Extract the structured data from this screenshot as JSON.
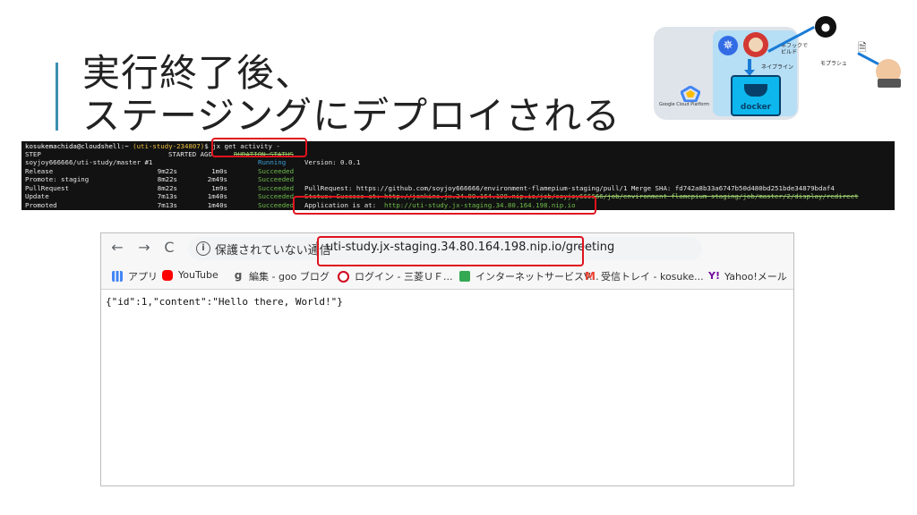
{
  "slide": {
    "title_line1": "実行終了後、",
    "title_line2": "ステージングにデプロイされる"
  },
  "diagram": {
    "gcp_label": "Google Cloud Platform",
    "docker_label": "docker",
    "label_build": "ビルド",
    "label_build_top": "ネフックで",
    "label_pipeline": "ネイプライン",
    "label_dev": "モプラシュ"
  },
  "terminal": {
    "prompt_user": "kosukemachida@cloudshell:~",
    "prompt_project": "(uti-study-234807)",
    "prompt_cmd": "$ jx get activity -",
    "header_step": "STEP",
    "header_started": "STARTED AGO",
    "header_duration_status": "DURATION STATUS",
    "rows": [
      {
        "step": "soyjoy666666/uti-study/master #1",
        "ago": "",
        "dur": "",
        "status": "Running",
        "detail": "Version: 0.0.1"
      },
      {
        "step": "  Release",
        "ago": "9m22s",
        "dur": "1m0s",
        "status": "Succeeded",
        "detail": ""
      },
      {
        "step": "  Promote: staging",
        "ago": "8m22s",
        "dur": "2m49s",
        "status": "Succeeded",
        "detail": ""
      },
      {
        "step": "    PullRequest",
        "ago": "8m22s",
        "dur": "1m9s",
        "status": "Succeeded",
        "detail": "PullRequest: https://github.com/soyjoy666666/environment-flamepium-staging/pull/1 Merge SHA: fd742a8b33a6747b50d480bd251bde34879bdaf4"
      },
      {
        "step": "    Update",
        "ago": "7m13s",
        "dur": "1m40s",
        "status": "Succeeded",
        "detail": "Status: Success at: http://jenkins.jx.34.80.164.198.nip.io/job/soyjoy666666/job/environment-flamepium-staging/job/master/2/display/redirect"
      },
      {
        "step": "    Promoted",
        "ago": "7m13s",
        "dur": "1m40s",
        "status": "Succeeded",
        "detail": "Application is at: ",
        "link": "http://uti-study.jx-staging.34.80.164.198.nip.io"
      }
    ]
  },
  "browser": {
    "back_icon": "←",
    "forward_icon": "→",
    "reload_icon": "C",
    "home_icon": "⌂",
    "info_icon": "i",
    "not_secure": "保護されていない通信",
    "url": "uti-study.jx-staging.34.80.164.198.nip.io/greeting",
    "bookmarks": [
      {
        "label": "アプリ",
        "color": "#4285f4"
      },
      {
        "label": "YouTube",
        "color": "#ff0000"
      },
      {
        "label": "編集 - goo ブログ",
        "color": "#e8e8e8"
      },
      {
        "label": "ログイン - 三菱ＵＦ...",
        "color": "#d0021b"
      },
      {
        "label": "インターネットサービスV...",
        "color": "#34a853"
      },
      {
        "label": "受信トレイ - kosuke...",
        "color": "#ea4335"
      },
      {
        "label": "Yahoo!メール",
        "color": "#720e9e"
      }
    ],
    "body_text": "{\"id\":1,\"content\":\"Hello there, World!\"}"
  }
}
